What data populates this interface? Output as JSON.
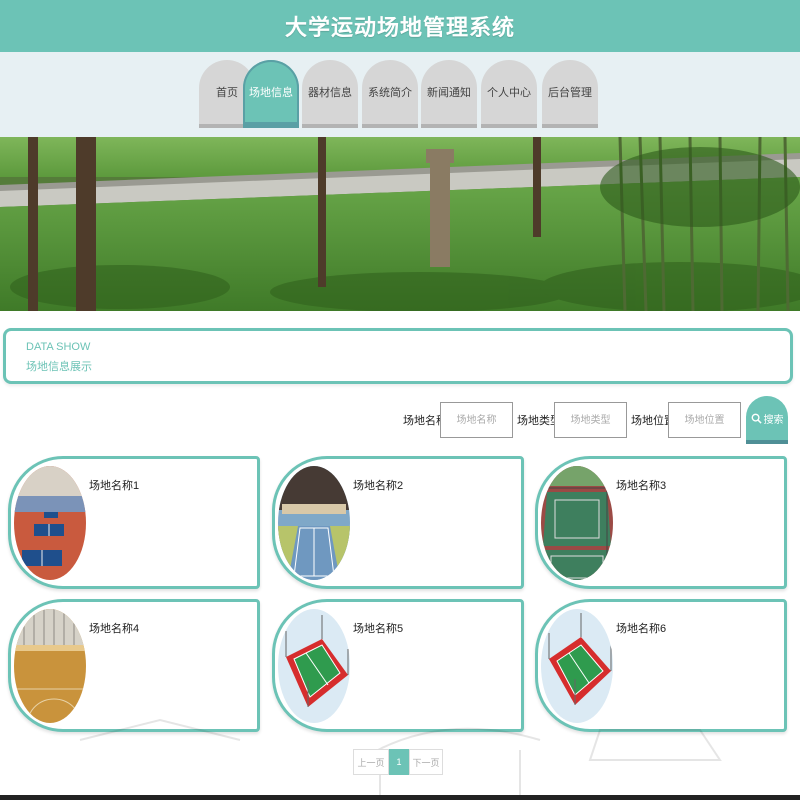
{
  "site": {
    "title": "大学运动场地管理系统"
  },
  "nav": {
    "items": [
      {
        "label": "首页"
      },
      {
        "label": "场地信息"
      },
      {
        "label": "器材信息"
      },
      {
        "label": "系统简介"
      },
      {
        "label": "新闻通知"
      },
      {
        "label": "个人中心"
      },
      {
        "label": "后台管理"
      }
    ],
    "active": "场地信息"
  },
  "datashow": {
    "title": "DATA SHOW",
    "subtitle": "场地信息展示"
  },
  "search": {
    "name_label": "场地名称",
    "name_placeholder": "场地名称",
    "type_label": "场地类型",
    "type_placeholder": "场地类型",
    "location_label": "场地位置",
    "location_placeholder": "场地位置",
    "button_label": "搜索"
  },
  "venues": [
    {
      "name": "场地名称1"
    },
    {
      "name": "场地名称2"
    },
    {
      "name": "场地名称3"
    },
    {
      "name": "场地名称4"
    },
    {
      "name": "场地名称5"
    },
    {
      "name": "场地名称6"
    }
  ],
  "pagination": {
    "prev_label": "上一页",
    "current_page": "1",
    "next_label": "下一页"
  },
  "colors": {
    "accent": "#6cc3b6",
    "nav_bg": "#e7f0f3",
    "tab_inactive": "#d6d6d6"
  }
}
